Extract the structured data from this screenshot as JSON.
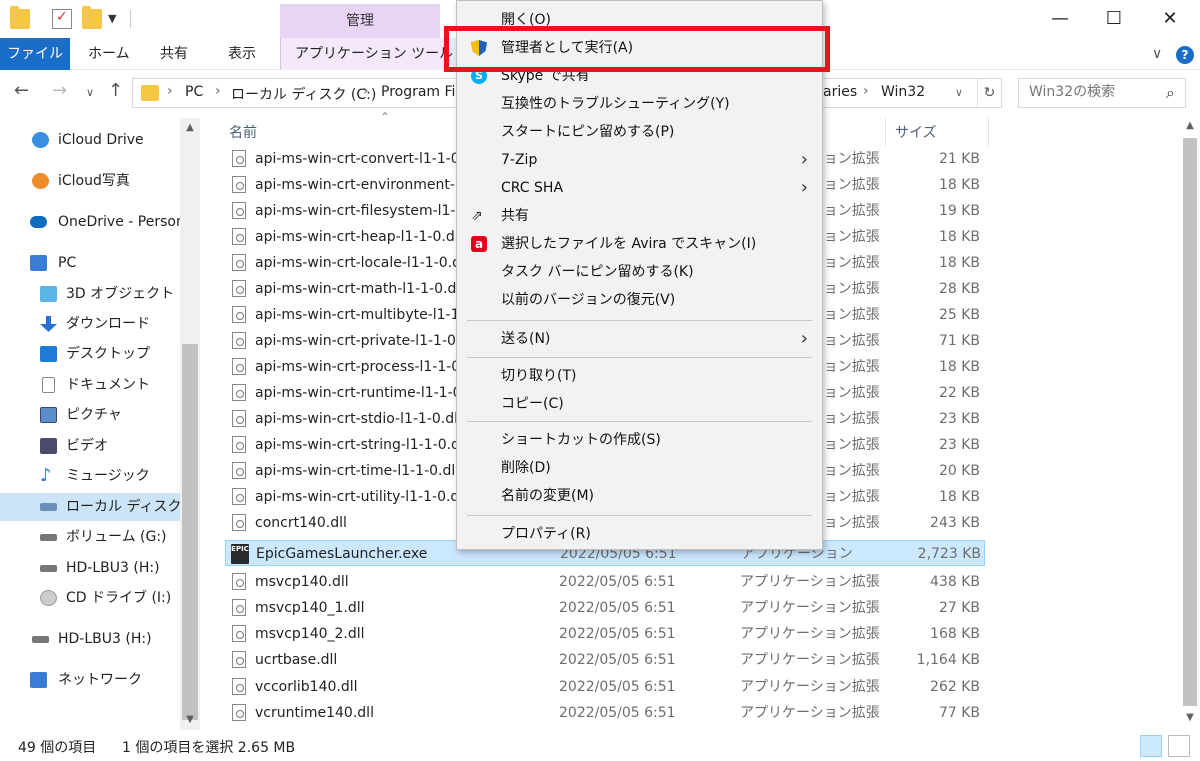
{
  "titlebar": {
    "manage_tab": "管理",
    "minimize": "—",
    "maximize": "☐",
    "close": "✕"
  },
  "ribbon": {
    "tabs": [
      "ファイル",
      "ホーム",
      "共有",
      "表示",
      "アプリケーション ツール"
    ],
    "collapse": "∨",
    "help": "?"
  },
  "address": {
    "crumbs": [
      "PC",
      "ローカル ディスク (C:)",
      "Program Fi",
      "aries",
      "Win32"
    ],
    "search_placeholder": "Win32の検索"
  },
  "sidebar": {
    "items": [
      {
        "label": "iCloud Drive",
        "icon": "icloud-icon",
        "color": "#3b8fe0"
      },
      {
        "label": "iCloud写真",
        "icon": "icloud-photos-icon",
        "color": "#f08c2a"
      },
      {
        "label": "OneDrive - Person",
        "icon": "onedrive-icon",
        "color": "#0f6cbd"
      },
      {
        "label": "PC",
        "icon": "pc-icon",
        "color": "#3a7bd5"
      },
      {
        "label": "3D オブジェクト",
        "icon": "3d-objects-icon",
        "color": "#5ab4e6"
      },
      {
        "label": "ダウンロード",
        "icon": "download-icon",
        "color": "#2b6fd4"
      },
      {
        "label": "デスクトップ",
        "icon": "desktop-icon",
        "color": "#1f7ad6"
      },
      {
        "label": "ドキュメント",
        "icon": "documents-icon",
        "color": "#8a8a8a"
      },
      {
        "label": "ピクチャ",
        "icon": "pictures-icon",
        "color": "#5a8ec8"
      },
      {
        "label": "ビデオ",
        "icon": "videos-icon",
        "color": "#4a4a6a"
      },
      {
        "label": "ミュージック",
        "icon": "music-icon",
        "color": "#2f7dd6"
      },
      {
        "label": "ローカル ディスク (C",
        "icon": "local-disk-icon",
        "color": "#6a8fb8"
      },
      {
        "label": "ボリューム (G:)",
        "icon": "drive-icon",
        "color": "#777777"
      },
      {
        "label": "HD-LBU3 (H:)",
        "icon": "drive-icon",
        "color": "#777777"
      },
      {
        "label": "CD ドライブ (I:)",
        "icon": "cd-drive-icon",
        "color": "#999999"
      },
      {
        "label": "HD-LBU3 (H:)",
        "icon": "drive-icon",
        "color": "#777777"
      },
      {
        "label": "ネットワーク",
        "icon": "network-icon",
        "color": "#3a7bd5"
      }
    ]
  },
  "filelist": {
    "columns": {
      "name": "名前",
      "size": "サイズ"
    },
    "rows": [
      {
        "name": "api-ms-win-crt-convert-l1-1-0",
        "date": "",
        "type": "アプリケーション拡張",
        "size": "21 KB"
      },
      {
        "name": "api-ms-win-crt-environment-l",
        "date": "",
        "type": "アプリケーション拡張",
        "size": "18 KB"
      },
      {
        "name": "api-ms-win-crt-filesystem-l1-1",
        "date": "",
        "type": "アプリケーション拡張",
        "size": "19 KB"
      },
      {
        "name": "api-ms-win-crt-heap-l1-1-0.dl",
        "date": "",
        "type": "アプリケーション拡張",
        "size": "18 KB"
      },
      {
        "name": "api-ms-win-crt-locale-l1-1-0.d",
        "date": "",
        "type": "アプリケーション拡張",
        "size": "18 KB"
      },
      {
        "name": "api-ms-win-crt-math-l1-1-0.dl",
        "date": "",
        "type": "アプリケーション拡張",
        "size": "28 KB"
      },
      {
        "name": "api-ms-win-crt-multibyte-l1-1",
        "date": "",
        "type": "アプリケーション拡張",
        "size": "25 KB"
      },
      {
        "name": "api-ms-win-crt-private-l1-1-0.",
        "date": "",
        "type": "アプリケーション拡張",
        "size": "71 KB"
      },
      {
        "name": "api-ms-win-crt-process-l1-1-0",
        "date": "",
        "type": "アプリケーション拡張",
        "size": "18 KB"
      },
      {
        "name": "api-ms-win-crt-runtime-l1-1-0",
        "date": "",
        "type": "アプリケーション拡張",
        "size": "22 KB"
      },
      {
        "name": "api-ms-win-crt-stdio-l1-1-0.dl",
        "date": "",
        "type": "アプリケーション拡張",
        "size": "23 KB"
      },
      {
        "name": "api-ms-win-crt-string-l1-1-0.d",
        "date": "",
        "type": "アプリケーション拡張",
        "size": "23 KB"
      },
      {
        "name": "api-ms-win-crt-time-l1-1-0.dll",
        "date": "",
        "type": "アプリケーション拡張",
        "size": "20 KB"
      },
      {
        "name": "api-ms-win-crt-utility-l1-1-0.d",
        "date": "",
        "type": "アプリケーション拡張",
        "size": "18 KB"
      },
      {
        "name": "concrt140.dll",
        "date": "",
        "type": "アプリケーション拡張",
        "size": "243 KB"
      },
      {
        "name": "EpicGamesLauncher.exe",
        "date": "2022/05/05 6:51",
        "type": "アプリケーション",
        "size": "2,723 KB",
        "selected": true
      },
      {
        "name": "msvcp140.dll",
        "date": "2022/05/05 6:51",
        "type": "アプリケーション拡張",
        "size": "438 KB"
      },
      {
        "name": "msvcp140_1.dll",
        "date": "2022/05/05 6:51",
        "type": "アプリケーション拡張",
        "size": "27 KB"
      },
      {
        "name": "msvcp140_2.dll",
        "date": "2022/05/05 6:51",
        "type": "アプリケーション拡張",
        "size": "168 KB"
      },
      {
        "name": "ucrtbase.dll",
        "date": "2022/05/05 6:51",
        "type": "アプリケーション拡張",
        "size": "1,164 KB"
      },
      {
        "name": "vccorlib140.dll",
        "date": "2022/05/05 6:51",
        "type": "アプリケーション拡張",
        "size": "262 KB"
      },
      {
        "name": "vcruntime140.dll",
        "date": "2022/05/05 6:51",
        "type": "アプリケーション拡張",
        "size": "77 KB"
      }
    ]
  },
  "context_menu": {
    "items": [
      {
        "label": "開く(O)",
        "icon": ""
      },
      {
        "label": "管理者として実行(A)",
        "icon": "admin-shield-icon"
      },
      {
        "label": "Skype で共有",
        "icon": "skype-icon"
      },
      {
        "label": "互換性のトラブルシューティング(Y)",
        "icon": ""
      },
      {
        "label": "スタートにピン留めする(P)",
        "icon": ""
      },
      {
        "label": "7-Zip",
        "icon": "",
        "submenu": true
      },
      {
        "label": "CRC SHA",
        "icon": "",
        "submenu": true
      },
      {
        "label": "共有",
        "icon": "share-icon"
      },
      {
        "label": "選択したファイルを Avira でスキャン(I)",
        "icon": "avira-icon"
      },
      {
        "label": "タスク バーにピン留めする(K)",
        "icon": ""
      },
      {
        "label": "以前のバージョンの復元(V)",
        "icon": ""
      },
      {
        "label": "送る(N)",
        "icon": "",
        "submenu": true
      },
      {
        "label": "切り取り(T)",
        "icon": ""
      },
      {
        "label": "コピー(C)",
        "icon": ""
      },
      {
        "label": "ショートカットの作成(S)",
        "icon": ""
      },
      {
        "label": "削除(D)",
        "icon": ""
      },
      {
        "label": "名前の変更(M)",
        "icon": ""
      },
      {
        "label": "プロパティ(R)",
        "icon": ""
      }
    ],
    "highlight_color": "#e8141c"
  },
  "status": {
    "count": "49 個の項目",
    "selection": "1 個の項目を選択  2.65 MB"
  }
}
